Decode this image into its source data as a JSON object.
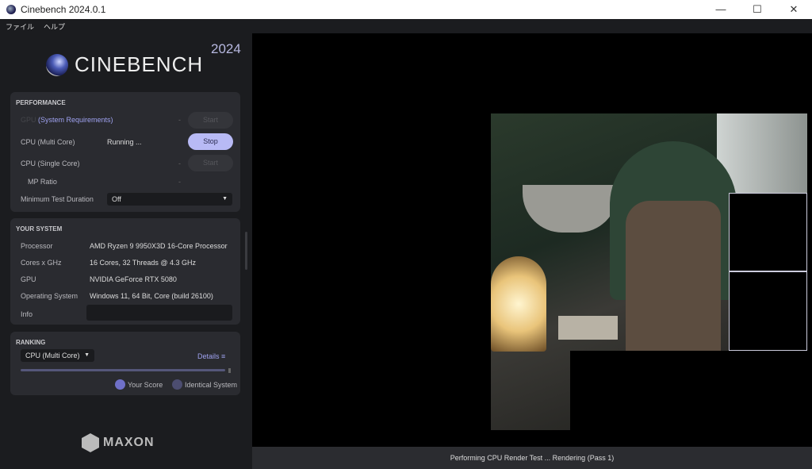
{
  "window": {
    "title": "Cinebench 2024.0.1",
    "controls": [
      "minimize",
      "maximize",
      "close"
    ]
  },
  "menu": [
    "ファイル",
    "ヘルプ"
  ],
  "brand": {
    "logo": "CINEBENCH",
    "year": "2024",
    "footer_logo": "MAXON"
  },
  "performance": {
    "heading": "PERFORMANCE",
    "gpu": {
      "label": "GPU",
      "link": "(System Requirements)",
      "value": "-",
      "button": "Start"
    },
    "cpu_multi": {
      "label": "CPU (Multi Core)",
      "value": "Running ...",
      "button": "Stop"
    },
    "cpu_single": {
      "label": "CPU (Single Core)",
      "value": "-",
      "button": "Start"
    },
    "mp_ratio": {
      "label": "MP Ratio",
      "value": "-"
    },
    "min_duration": {
      "label": "Minimum Test Duration",
      "value": "Off"
    }
  },
  "system": {
    "heading": "YOUR SYSTEM",
    "rows": [
      {
        "label": "Processor",
        "value": "AMD Ryzen 9 9950X3D 16-Core Processor"
      },
      {
        "label": "Cores x GHz",
        "value": "16 Cores, 32 Threads @ 4.3 GHz"
      },
      {
        "label": "GPU",
        "value": "NVIDIA GeForce RTX 5080"
      },
      {
        "label": "Operating System",
        "value": "Windows 11, 64 Bit, Core (build 26100)"
      }
    ],
    "info_label": "Info",
    "info_value": ""
  },
  "ranking": {
    "heading": "RANKING",
    "select": "CPU (Multi Core)",
    "details": "Details",
    "legend": [
      {
        "label": "Your Score",
        "color": "#6f70c8"
      },
      {
        "label": "Identical System",
        "color": "#4c4d70"
      }
    ]
  },
  "status": "Performing CPU Render Test ... Rendering (Pass 1)"
}
